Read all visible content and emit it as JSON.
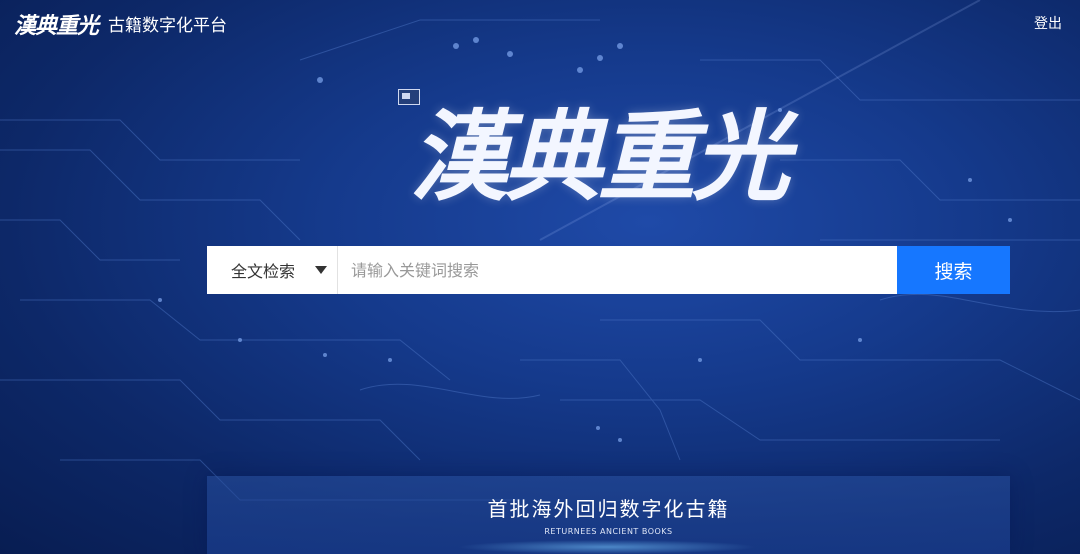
{
  "header": {
    "logo_text": "漢典重光",
    "platform_name": "古籍数字化平台",
    "logout_label": "登出"
  },
  "hero": {
    "title": "漢典重光"
  },
  "search": {
    "scope_selected": "全文检索",
    "placeholder": "请输入关键词搜索",
    "button_label": "搜索"
  },
  "banner": {
    "title": "首批海外回归数字化古籍",
    "subtitle": "RETURNEES ANCIENT BOOKS"
  },
  "colors": {
    "accent": "#1677ff",
    "background": "#153a8c"
  }
}
